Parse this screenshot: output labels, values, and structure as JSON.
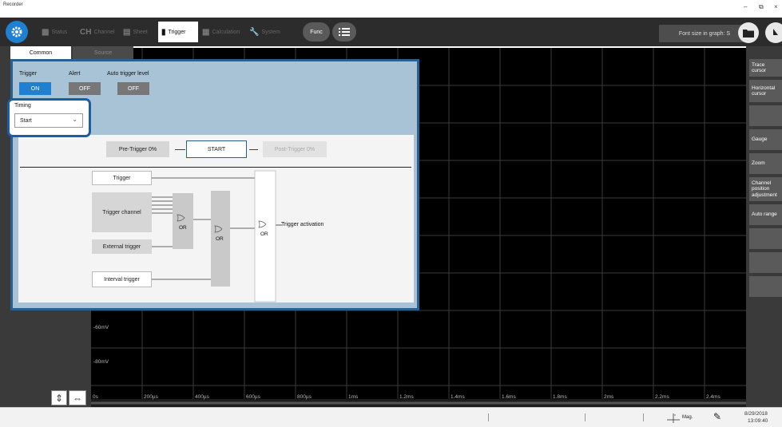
{
  "app": {
    "title": "Recorder"
  },
  "window_controls": {
    "minimize": "–",
    "restore": "⧉",
    "close": "×"
  },
  "toolbar": {
    "tabs": [
      {
        "icon": "▩",
        "label": "Status"
      },
      {
        "icon": "CH",
        "label": "Channel"
      },
      {
        "icon": "▤",
        "label": "Sheet"
      },
      {
        "icon": "▮",
        "label": "Trigger"
      },
      {
        "icon": "▦",
        "label": "Calculation"
      },
      {
        "icon": "🔧",
        "label": "System"
      }
    ],
    "func_label": "Func",
    "font_size_label": "Font size in graph: S"
  },
  "subtabs": {
    "common": "Common",
    "source": "Source"
  },
  "trigger_panel": {
    "trigger_label": "Trigger",
    "trigger_value": "ON",
    "alert_label": "Alert",
    "alert_value": "OFF",
    "auto_label": "Auto trigger level",
    "auto_value": "OFF",
    "timing_label": "Timing",
    "timing_value": "Start",
    "pre_trigger": "Pre-Trigger 0%",
    "start": "START",
    "post_trigger": "Post-Trigger 0%",
    "diagram": {
      "trigger": "Trigger",
      "trigger_channel": "Trigger channel",
      "external_trigger": "External trigger",
      "interval_trigger": "Interval trigger",
      "or1": "OR",
      "or2": "OR",
      "or3": "OR",
      "activation": "Trigger activation"
    }
  },
  "graph": {
    "y_labels": [
      "-60mV",
      "-80mV"
    ],
    "x_labels": [
      "0s",
      "200µs",
      "400µs",
      "600µs",
      "800µs",
      "1ms",
      "1.2ms",
      "1.4ms",
      "1.6ms",
      "1.8ms",
      "2ms",
      "2.2ms",
      "2.4ms"
    ]
  },
  "right_panel": {
    "buttons": [
      "Trace cursor",
      "Horizontal cursor",
      "",
      "Gauge",
      "Zoom",
      "Channel position adjustment",
      "Auto range",
      "",
      "",
      ""
    ]
  },
  "statusbar": {
    "mag": "Mag.",
    "date": "8/29/2018",
    "time": "13:09:40"
  },
  "colors": {
    "accent": "#1f7fd0",
    "timing_highlight": "#1a5ea8",
    "graph_bg": "#000000"
  }
}
